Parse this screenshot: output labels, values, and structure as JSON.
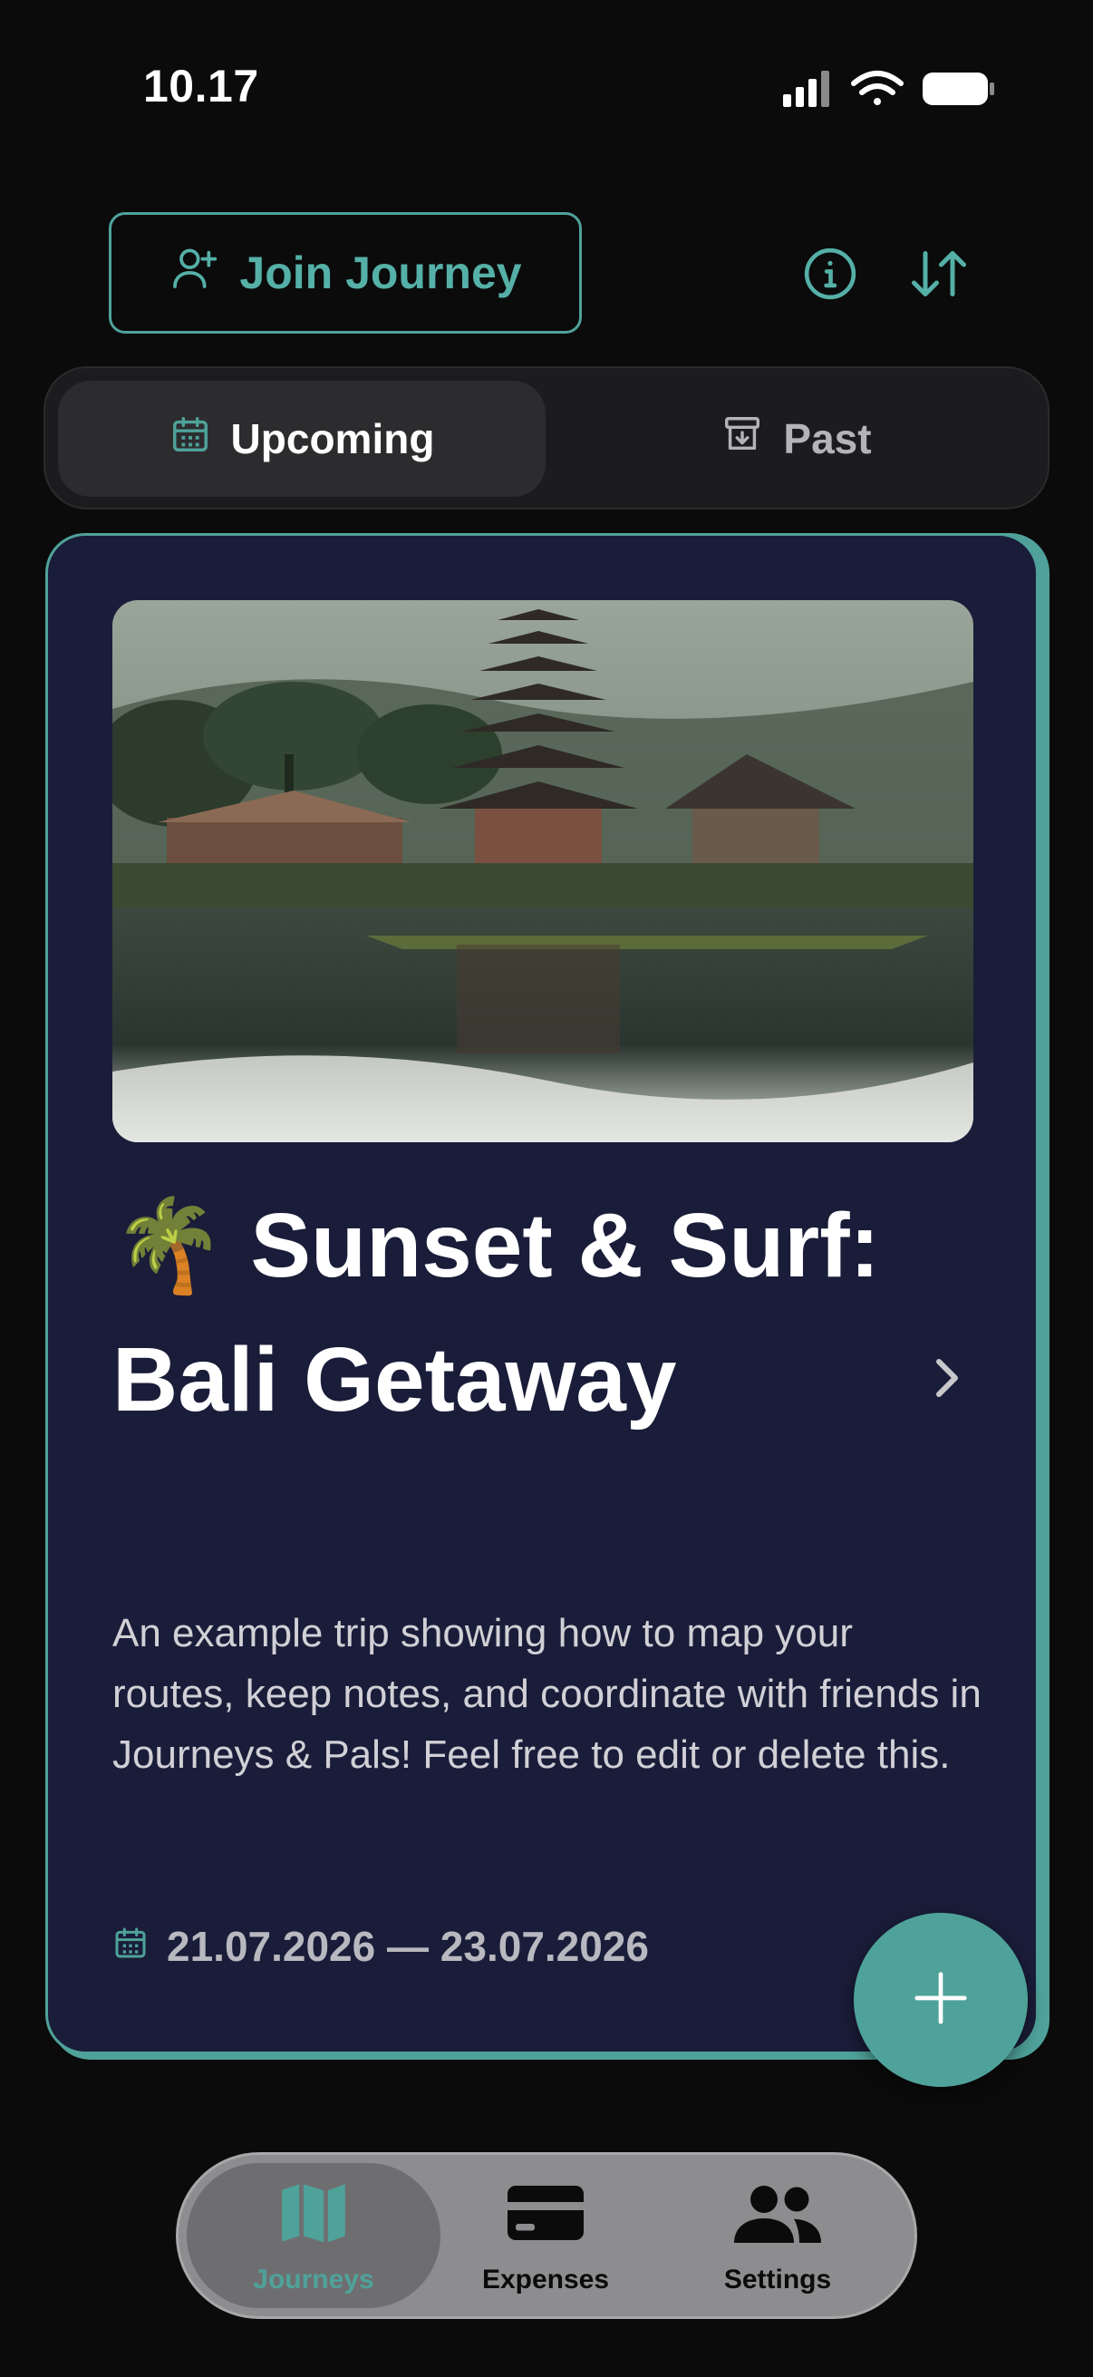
{
  "status": {
    "time": "10.17"
  },
  "header": {
    "join_label": "Join Journey",
    "info_icon": "info-icon",
    "sort_icon": "sort-icon"
  },
  "segments": {
    "upcoming_label": "Upcoming",
    "past_label": "Past",
    "selected": "Upcoming"
  },
  "trip": {
    "emoji": "🌴",
    "title": "Sunset & Surf: Bali Getaway",
    "description": "An example trip showing how to map your routes, keep notes, and coordinate with friends in Journeys & Pals! Feel free to edit or delete this.",
    "dates": "21.07.2026 — 23.07.2026"
  },
  "tabs": [
    {
      "label": "Journeys",
      "icon": "map-icon",
      "active": true
    },
    {
      "label": "Expenses",
      "icon": "card-icon",
      "active": false
    },
    {
      "label": "Settings",
      "icon": "people-icon",
      "active": false
    }
  ],
  "colors": {
    "accent": "#4fa29a",
    "card_bg": "#1a1d39",
    "background": "#0b0b0c"
  }
}
